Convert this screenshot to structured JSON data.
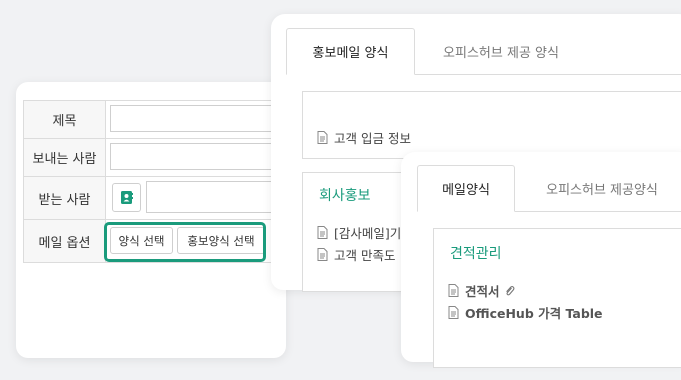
{
  "mail_form": {
    "rows": [
      {
        "label": "제목"
      },
      {
        "label": "보내는 사람"
      },
      {
        "label": "받는 사람"
      },
      {
        "label": "메일 옵션"
      }
    ],
    "options": {
      "template_select": "양식 선택",
      "promo_template_select": "홍보양식 선택"
    },
    "highlight_color": "#1a9b7c"
  },
  "promo_panel": {
    "tabs": [
      {
        "label": "홍보메일 양식",
        "active": true
      },
      {
        "label": "오피스허브 제공 양식",
        "active": false
      }
    ],
    "first_group": {
      "items": [
        "고객 입금 정보"
      ]
    },
    "section_title": "회사홍보",
    "section_items": [
      "[감사메일]기",
      "고객 만족도"
    ]
  },
  "form_panel": {
    "tabs": [
      {
        "label": "메일양식",
        "active": true
      },
      {
        "label": "오피스허브 제공양식",
        "active": false
      }
    ],
    "section_title": "견적관리",
    "items": [
      {
        "label": "견적서",
        "attachment_icon": "paperclip-icon"
      },
      {
        "label": "OfficeHub 가격 Table"
      }
    ]
  }
}
